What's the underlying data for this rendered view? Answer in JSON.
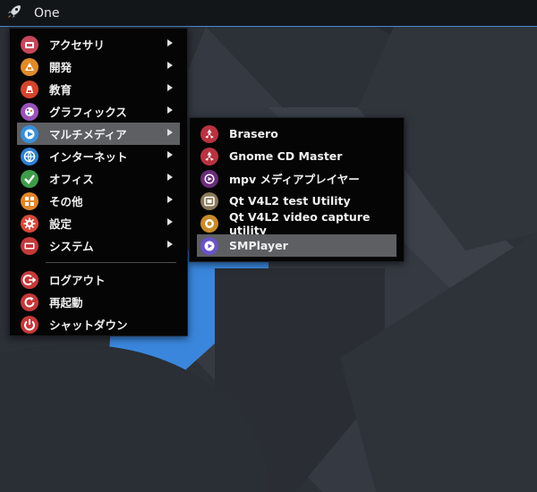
{
  "panel": {
    "launcher_label": "One"
  },
  "colors": {
    "panel_bg": "#131619",
    "accent": "#4a88d6",
    "highlight": "#5d5f62",
    "menu_bg": "#050506"
  },
  "main_menu": {
    "categories": [
      {
        "label": "アクセサリ",
        "icon": "accessories-icon",
        "color": "#c4475a"
      },
      {
        "label": "開発",
        "icon": "development-icon",
        "color": "#e08a2a"
      },
      {
        "label": "教育",
        "icon": "education-icon",
        "color": "#d4452e"
      },
      {
        "label": "グラフィックス",
        "icon": "graphics-icon",
        "color": "#9a52b7"
      },
      {
        "label": "マルチメディア",
        "icon": "multimedia-icon",
        "color": "#3a8fd8",
        "highlighted": true
      },
      {
        "label": "インターネット",
        "icon": "internet-icon",
        "color": "#2f7fd0"
      },
      {
        "label": "オフィス",
        "icon": "office-icon",
        "color": "#3f9c4a"
      },
      {
        "label": "その他",
        "icon": "other-icon",
        "color": "#e0862a"
      },
      {
        "label": "設定",
        "icon": "settings-icon",
        "color": "#d64a3a"
      },
      {
        "label": "システム",
        "icon": "system-icon",
        "color": "#c4393a"
      }
    ],
    "actions": [
      {
        "label": "ログアウト",
        "icon": "logout-icon",
        "color": "#c4393a"
      },
      {
        "label": "再起動",
        "icon": "restart-icon",
        "color": "#c4393a"
      },
      {
        "label": "シャットダウン",
        "icon": "shutdown-icon",
        "color": "#c4393a"
      }
    ]
  },
  "submenu": {
    "items": [
      {
        "label": "Brasero",
        "icon": "brasero-icon",
        "color": "#b8333f"
      },
      {
        "label": "Gnome CD Master",
        "icon": "gnome-cd-master-icon",
        "color": "#b8333f"
      },
      {
        "label": "mpv メディアプレイヤー",
        "icon": "mpv-icon",
        "color": "#6a2c7a"
      },
      {
        "label": "Qt V4L2 test Utility",
        "icon": "qt-v4l2-test-icon",
        "color": "#8a7a5a"
      },
      {
        "label": "Qt V4L2 video capture utility",
        "icon": "qt-v4l2-capture-icon",
        "color": "#c88a2a"
      },
      {
        "label": "SMPlayer",
        "icon": "smplayer-icon",
        "color": "#6a52c8",
        "highlighted": true
      }
    ]
  }
}
